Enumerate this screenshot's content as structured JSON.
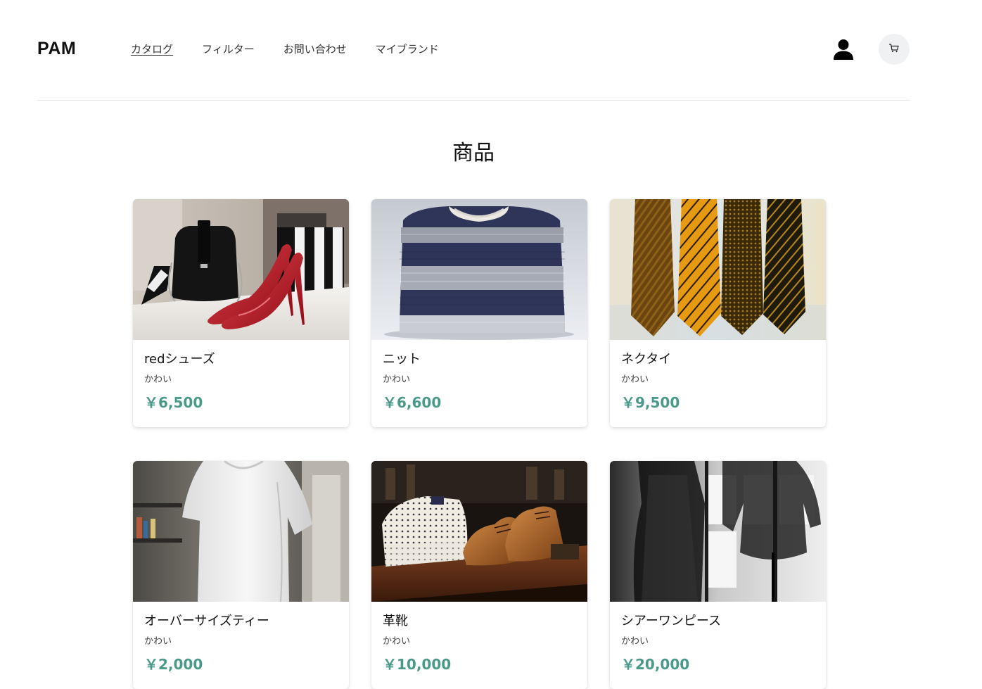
{
  "header": {
    "logo": "PAM",
    "nav": [
      {
        "label": "カタログ",
        "active": true
      },
      {
        "label": "フィルター",
        "active": false
      },
      {
        "label": "お問い合わせ",
        "active": false
      },
      {
        "label": "マイブランド",
        "active": false
      }
    ],
    "icons": {
      "user": "user-icon",
      "cart": "cart-icon"
    }
  },
  "main": {
    "title": "商品",
    "products": [
      {
        "name": "redシューズ",
        "desc": "かわい",
        "price": "￥6,500",
        "image": "red-heels-and-handbag"
      },
      {
        "name": "ニット",
        "desc": "かわい",
        "price": "￥6,600",
        "image": "striped-knit-sweater"
      },
      {
        "name": "ネクタイ",
        "desc": "かわい",
        "price": "￥9,500",
        "image": "four-neckties"
      },
      {
        "name": "オーバーサイズティー",
        "desc": "かわい",
        "price": "￥2,000",
        "image": "white-oversized-tshirt"
      },
      {
        "name": "革靴",
        "desc": "かわい",
        "price": "￥10,000",
        "image": "leather-shoes-and-shirts"
      },
      {
        "name": "シアーワンピース",
        "desc": "かわい",
        "price": "￥20,000",
        "image": "sheer-dress-monochrome"
      }
    ]
  },
  "colors": {
    "price": "#4a9a8a",
    "cart_bg": "#f0f1f3",
    "divider": "#e6e6e6"
  }
}
